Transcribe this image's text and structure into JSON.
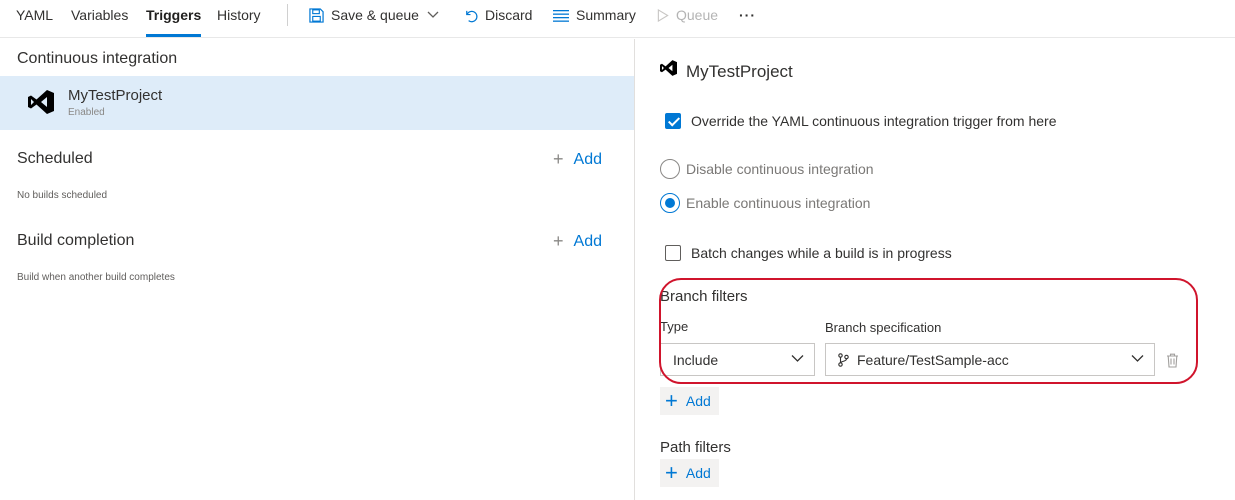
{
  "toolbar": {
    "tabs": [
      "YAML",
      "Variables",
      "Triggers",
      "History"
    ],
    "active_tab": "Triggers",
    "save_queue_label": "Save & queue",
    "discard_label": "Discard",
    "summary_label": "Summary",
    "queue_label": "Queue",
    "more_label": "···"
  },
  "left": {
    "ci_title": "Continuous integration",
    "ci_item": {
      "name": "MyTestProject",
      "status": "Enabled"
    },
    "scheduled_title": "Scheduled",
    "scheduled_note": "No builds scheduled",
    "build_completion_title": "Build completion",
    "build_completion_note": "Build when another build completes",
    "add_label": "Add"
  },
  "right": {
    "title": "MyTestProject",
    "override_label": "Override the YAML continuous integration trigger from here",
    "override_checked": true,
    "disable_ci_label": "Disable continuous integration",
    "enable_ci_label": "Enable continuous integration",
    "ci_selected": "enable",
    "batch_label": "Batch changes while a build is in progress",
    "batch_checked": false,
    "branch_filters": {
      "title": "Branch filters",
      "type_label": "Type",
      "branch_spec_label": "Branch specification",
      "type_value": "Include",
      "branch_value": "Feature/TestSample-acc"
    },
    "add_label": "Add",
    "path_filters_title": "Path filters"
  },
  "colors": {
    "accent": "#0078d4",
    "highlight": "#d0142c",
    "selected_row": "#deecf9"
  }
}
